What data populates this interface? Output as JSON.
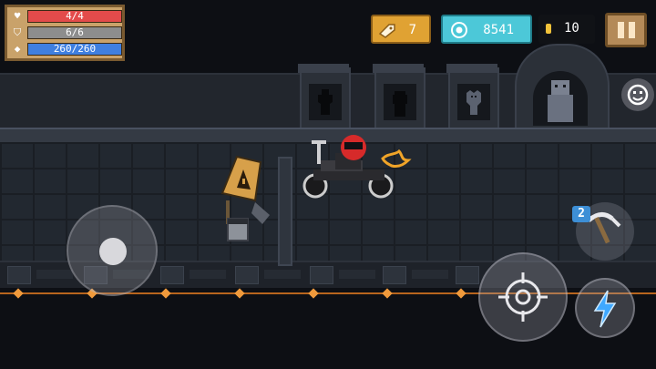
{
  "hud": {
    "health": {
      "text": "4/4",
      "fraction": 1.0,
      "color": "#e34b4b",
      "icon": "heart-icon"
    },
    "armor": {
      "text": "6/6",
      "fraction": 1.0,
      "color": "#8d8d8d",
      "icon": "shield-icon"
    },
    "energy": {
      "text": "260/260",
      "fraction": 1.0,
      "color": "#3f7fe0",
      "icon": "energy-crystal-icon"
    },
    "gems": {
      "value": "7",
      "icon": "fish-gem-icon"
    },
    "energy_currency": {
      "value": "8541",
      "icon": "energy-orb-icon"
    },
    "coins": {
      "value": "10",
      "icon": "coin-icon"
    }
  },
  "controls": {
    "weapon_count": "2",
    "movement": "virtual-joystick",
    "attack": "crosshair-icon",
    "skill": "lightning-icon",
    "emote": "smiley-icon",
    "pause": "pause-icon"
  },
  "colors": {
    "accent_gold": "#e0a233",
    "accent_cyan": "#4cc8d8",
    "panel_tan": "#c9a26a",
    "lava": "#f09a3c"
  }
}
